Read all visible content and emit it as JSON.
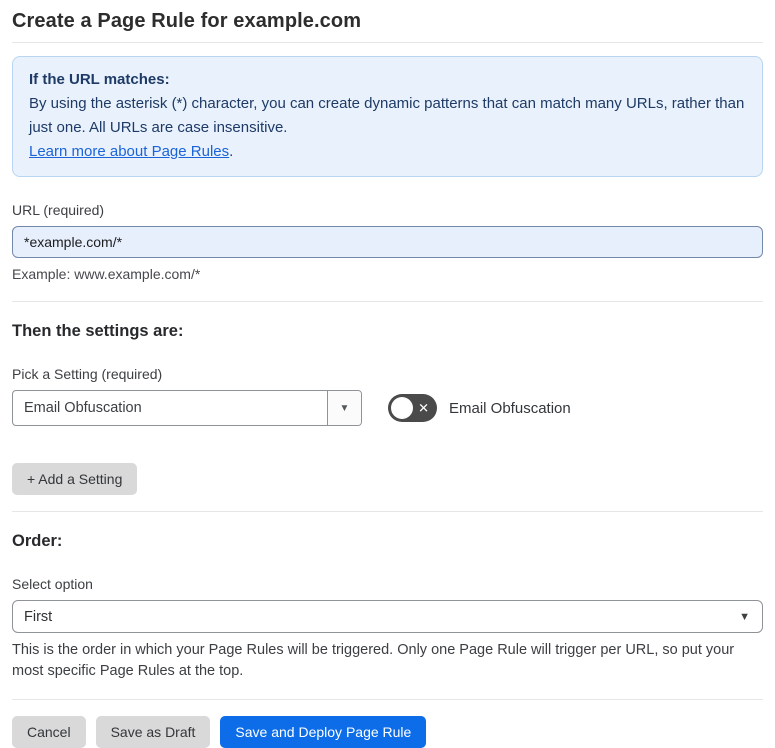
{
  "page": {
    "title": "Create a Page Rule for example.com"
  },
  "info_box": {
    "heading": "If the URL matches:",
    "body": "By using the asterisk (*) character, you can create dynamic patterns that can match many URLs, rather than just one. All URLs are case insensitive.",
    "link_label": "Learn more about Page Rules",
    "link_suffix": "."
  },
  "url_section": {
    "label": "URL (required)",
    "input_value": "*example.com/*",
    "helper": "Example: www.example.com/*"
  },
  "settings_section": {
    "heading": "Then the settings are:",
    "picker_label": "Pick a Setting (required)",
    "picker_value": "Email Obfuscation",
    "toggle_label": "Email Obfuscation",
    "toggle_state": "off",
    "add_button_label": "+ Add a Setting"
  },
  "order_section": {
    "heading": "Order:",
    "select_label": "Select option",
    "select_value": "First",
    "helper": "This is the order in which your Page Rules will be triggered. Only one Page Rule will trigger per URL, so put your most specific Page Rules at the top."
  },
  "footer": {
    "cancel_label": "Cancel",
    "save_draft_label": "Save as Draft",
    "save_deploy_label": "Save and Deploy Page Rule"
  },
  "icons": {
    "caret_down": "▼",
    "toggle_off_x": "✕"
  },
  "colors": {
    "accent_blue": "#0d6ce8",
    "info_bg": "#e9f2fc",
    "info_border": "#b9d5f1",
    "info_text": "#1e3a66",
    "link_blue": "#1a63d9",
    "input_bg": "#e7eefc",
    "toggle_off_bg": "#4a4a4a",
    "gray_button_bg": "#d9d9d9"
  }
}
